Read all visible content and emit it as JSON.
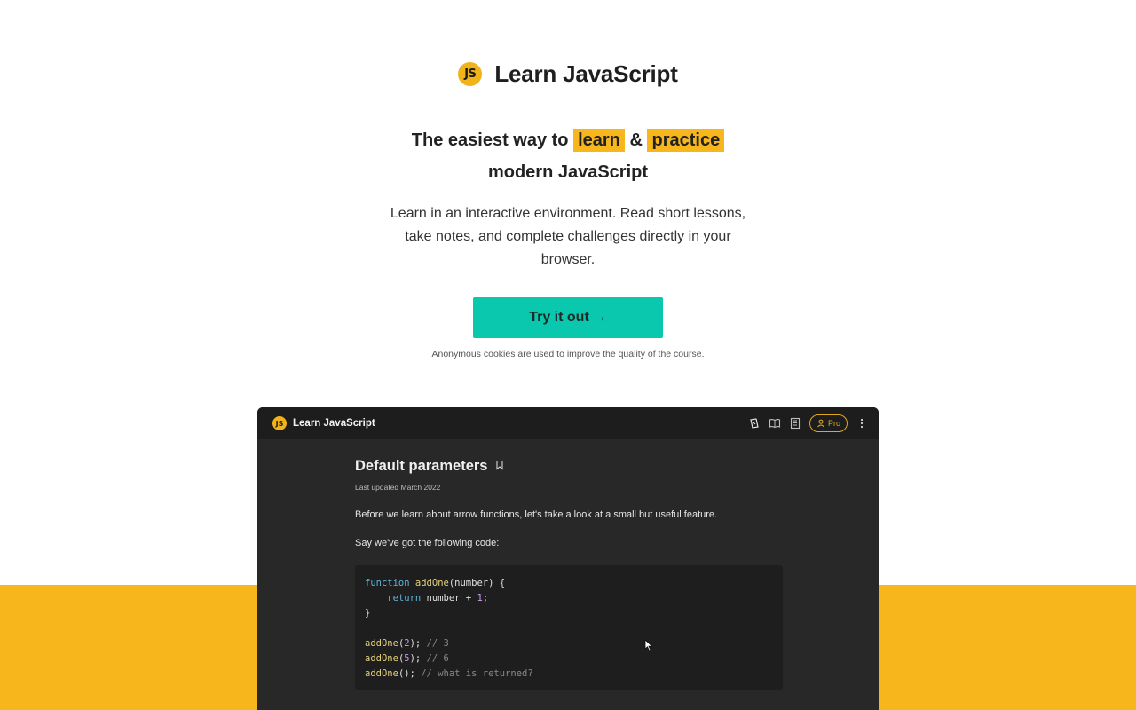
{
  "brand": {
    "logo_text": "JS",
    "title": "Learn JavaScript"
  },
  "headline": {
    "prefix": "The easiest way to",
    "highlight1": "learn",
    "amp": "&",
    "highlight2": "practice",
    "line2": "modern JavaScript"
  },
  "subtext": "Learn in an interactive environment. Read short lessons, take notes, and complete challenges directly in your browser.",
  "cta": {
    "label": "Try it out",
    "arrow": "→"
  },
  "cookie_note": "Anonymous cookies are used to improve the quality of the course.",
  "colors": {
    "accent_yellow": "#f7b61b",
    "cta_teal": "#0ac8ad",
    "app_bg": "#282828"
  },
  "app": {
    "logo_text": "JS",
    "title": "Learn JavaScript",
    "tools": [
      "cards-icon",
      "book-icon",
      "notes-icon",
      "pro-badge",
      "more-vertical-icon"
    ],
    "pro_label": "Pro",
    "lesson": {
      "title": "Default parameters",
      "updated": "Last updated March 2022",
      "p1": "Before we learn about arrow functions, let's take a look at a small but useful feature.",
      "p2": "Say we've got the following code:",
      "code": {
        "l1_kw": "function",
        "l1_fn": "addOne",
        "l1_rest": "(number) {",
        "l2_kw": "return",
        "l2_rest": " number + ",
        "l2_num": "1",
        "l2_end": ";",
        "l3": "}",
        "l5_fn": "addOne",
        "l5_open": "(",
        "l5_num": "2",
        "l5_close": "); ",
        "l5_cm": "// 3",
        "l6_fn": "addOne",
        "l6_open": "(",
        "l6_num": "5",
        "l6_close": "); ",
        "l6_cm": "// 6",
        "l7_fn": "addOne",
        "l7_rest": "(); ",
        "l7_cm": "// what is returned?"
      }
    }
  }
}
